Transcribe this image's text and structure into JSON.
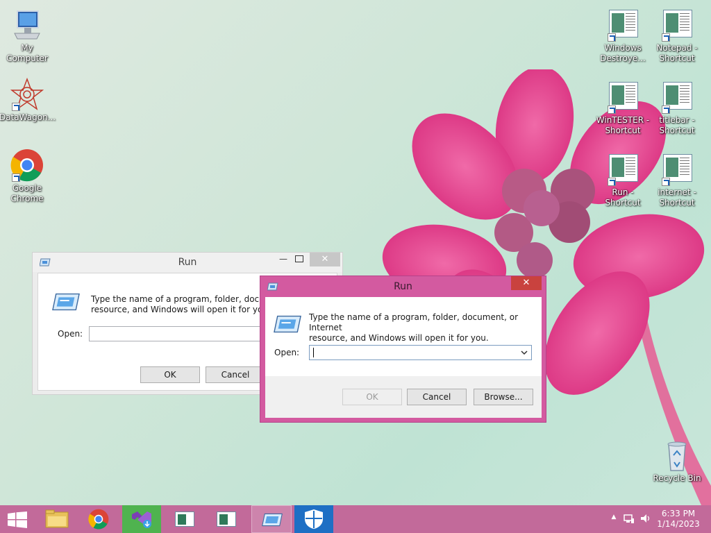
{
  "desktop": {
    "left_icons": [
      {
        "label": "My Computer",
        "icon": "computer-icon"
      },
      {
        "label": "DataWagon...",
        "icon": "datawagon-icon"
      },
      {
        "label": "Google Chrome",
        "icon": "chrome-icon"
      }
    ],
    "right_icons": [
      {
        "label": "Windows Destroye...",
        "icon": "shortcut-doc-icon"
      },
      {
        "label": "Notepad - Shortcut",
        "icon": "shortcut-doc-icon"
      },
      {
        "label": "WinTESTER - Shortcut",
        "icon": "shortcut-doc-icon"
      },
      {
        "label": "titlebar - Shortcut",
        "icon": "shortcut-doc-icon"
      },
      {
        "label": "Run - Shortcut",
        "icon": "shortcut-doc-icon"
      },
      {
        "label": "internet - Shortcut",
        "icon": "shortcut-doc-icon"
      }
    ],
    "recycle_bin": {
      "label": "Recycle Bin",
      "icon": "recycle-bin-icon"
    }
  },
  "bg_dialog": {
    "title": "Run",
    "description_line1": "Type the name of a program, folder, documen",
    "description_line2": "resource, and Windows will open it for you.",
    "open_label": "Open:",
    "ok_label": "OK",
    "cancel_label": "Cancel"
  },
  "fg_dialog": {
    "title": "Run",
    "close_glyph": "✕",
    "description_line1": "Type the name of a program, folder, document, or Internet",
    "description_line2": "resource, and Windows will open it for you.",
    "open_label": "Open:",
    "open_value": "",
    "ok_label": "OK",
    "cancel_label": "Cancel",
    "browse_label": "Browse..."
  },
  "taskbar": {
    "items": [
      {
        "name": "start-button",
        "icon": "windows-logo-icon"
      },
      {
        "name": "file-explorer",
        "icon": "folder-icon"
      },
      {
        "name": "chrome",
        "icon": "chrome-icon"
      },
      {
        "name": "visual-studio-installer",
        "icon": "visual-studio-icon"
      },
      {
        "name": "app-window-1",
        "icon": "app-window-icon"
      },
      {
        "name": "app-window-2",
        "icon": "app-window-icon"
      },
      {
        "name": "run-dialog",
        "icon": "run-icon"
      },
      {
        "name": "windows-defender",
        "icon": "shield-icon"
      }
    ],
    "time": "6:33 PM",
    "date": "1/14/2023"
  },
  "colors": {
    "accent": "#d35aa0",
    "taskbar": "#c26a9a",
    "close_button": "#c9423e"
  }
}
